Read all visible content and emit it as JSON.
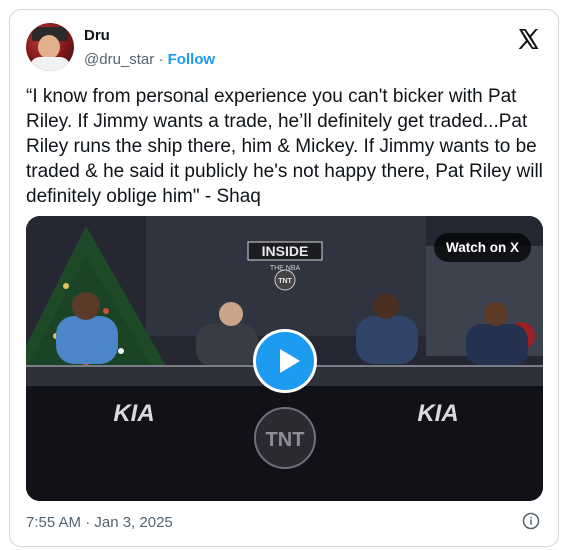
{
  "author": {
    "name": "Dru",
    "handle": "@dru_star",
    "separator": "·",
    "follow_label": "Follow"
  },
  "platform_icon": "x-logo-icon",
  "tweet": {
    "text": "“I know from personal experience you can't bicker with Pat Riley. If Jimmy wants a trade, he’ll definitely get traded...Pat Riley runs the ship there, him & Mickey. If Jimmy wants to be traded & he said it publicly he's not happy there, Pat Riley will definitely oblige him\" - Shaq"
  },
  "media": {
    "watch_label": "Watch on X",
    "play_icon": "play-icon",
    "set_logo_top": "INSIDE",
    "set_logo_mid": "THE NBA",
    "set_logo_badge": "TNT",
    "desk_brand_left": "KIA",
    "desk_brand_right": "KIA",
    "desk_center_logo": "TNT"
  },
  "timestamp": "7:55 AM · Jan 3, 2025",
  "info_icon": "info-icon",
  "colors": {
    "accent": "#1d9bf0",
    "text_primary": "#0f1419",
    "text_secondary": "#536471",
    "border": "#cfd9de"
  }
}
